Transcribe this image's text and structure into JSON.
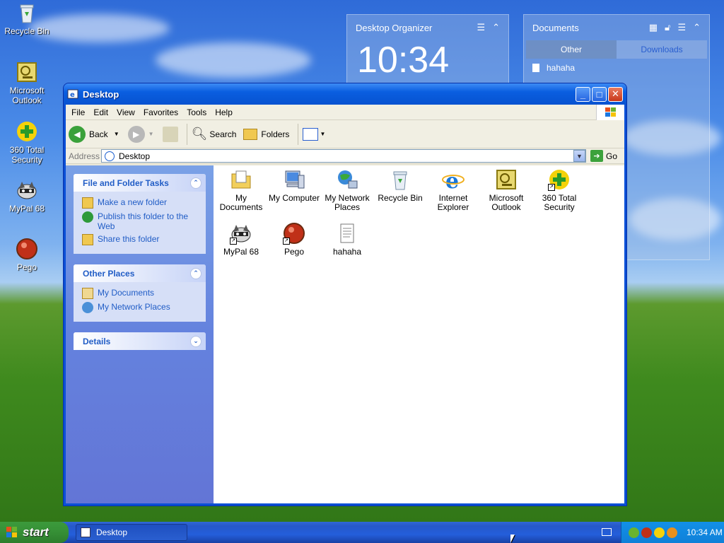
{
  "desktop_icons": [
    {
      "label": "Recycle Bin"
    },
    {
      "label": "Microsoft Outlook"
    },
    {
      "label": "360 Total Security"
    },
    {
      "label": "MyPal 68"
    },
    {
      "label": "Pego"
    }
  ],
  "gadget_clock": {
    "title": "Desktop Organizer",
    "time": "10:34"
  },
  "gadget_docs": {
    "title": "Documents",
    "tab_other": "Other",
    "tab_downloads": "Downloads",
    "item": "hahaha"
  },
  "window": {
    "title": "Desktop",
    "menu": [
      "File",
      "Edit",
      "View",
      "Favorites",
      "Tools",
      "Help"
    ],
    "toolbar": {
      "back": "Back",
      "search": "Search",
      "folders": "Folders"
    },
    "address_label": "Address",
    "address_value": "Desktop",
    "go_label": "Go"
  },
  "taskpane": {
    "file_tasks": {
      "title": "File and Folder Tasks",
      "items": [
        "Make a new folder",
        "Publish this folder to the Web",
        "Share this folder"
      ]
    },
    "other_places": {
      "title": "Other Places",
      "items": [
        "My Documents",
        "My Network Places"
      ]
    },
    "details": {
      "title": "Details"
    }
  },
  "files": [
    {
      "label": "My Documents"
    },
    {
      "label": "My Computer"
    },
    {
      "label": "My Network Places"
    },
    {
      "label": "Recycle Bin"
    },
    {
      "label": "Internet Explorer"
    },
    {
      "label": "Microsoft Outlook"
    },
    {
      "label": "360 Total Security"
    },
    {
      "label": "MyPal 68"
    },
    {
      "label": "Pego"
    },
    {
      "label": "hahaha"
    }
  ],
  "taskbar": {
    "start": "start",
    "task": "Desktop",
    "clock": "10:34 AM"
  },
  "colors": {
    "xp_blue": "#0a4fd6",
    "taskpane_link": "#215dc6",
    "start_green": "#379237"
  }
}
